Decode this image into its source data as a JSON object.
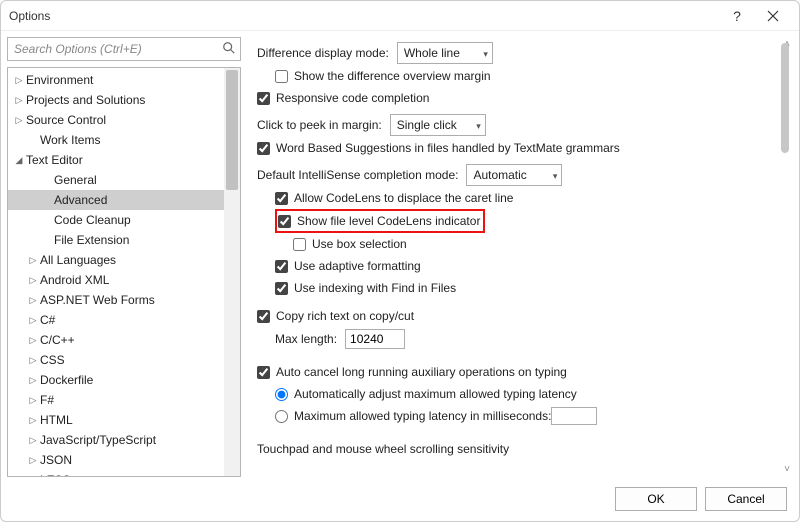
{
  "title": "Options",
  "search": {
    "placeholder": "Search Options (Ctrl+E)"
  },
  "tree": {
    "items": [
      {
        "label": "Environment",
        "glyph": "▷",
        "indent": 4
      },
      {
        "label": "Projects and Solutions",
        "glyph": "▷",
        "indent": 4
      },
      {
        "label": "Source Control",
        "glyph": "▷",
        "indent": 4
      },
      {
        "label": "Work Items",
        "glyph": "",
        "indent": 18
      },
      {
        "label": "Text Editor",
        "glyph": "◢",
        "indent": 4
      },
      {
        "label": "General",
        "glyph": "",
        "indent": 32
      },
      {
        "label": "Advanced",
        "glyph": "",
        "indent": 32,
        "selected": true
      },
      {
        "label": "Code Cleanup",
        "glyph": "",
        "indent": 32
      },
      {
        "label": "File Extension",
        "glyph": "",
        "indent": 32
      },
      {
        "label": "All Languages",
        "glyph": "▷",
        "indent": 18
      },
      {
        "label": "Android XML",
        "glyph": "▷",
        "indent": 18
      },
      {
        "label": "ASP.NET Web Forms",
        "glyph": "▷",
        "indent": 18
      },
      {
        "label": "C#",
        "glyph": "▷",
        "indent": 18
      },
      {
        "label": "C/C++",
        "glyph": "▷",
        "indent": 18
      },
      {
        "label": "CSS",
        "glyph": "▷",
        "indent": 18
      },
      {
        "label": "Dockerfile",
        "glyph": "▷",
        "indent": 18
      },
      {
        "label": "F#",
        "glyph": "▷",
        "indent": 18
      },
      {
        "label": "HTML",
        "glyph": "▷",
        "indent": 18
      },
      {
        "label": "JavaScript/TypeScript",
        "glyph": "▷",
        "indent": 18
      },
      {
        "label": "JSON",
        "glyph": "▷",
        "indent": 18
      },
      {
        "label": "LESS",
        "glyph": "▷",
        "indent": 18
      }
    ]
  },
  "panel": {
    "diff_mode_label": "Difference display mode:",
    "diff_mode_value": "Whole line",
    "show_diff_margin": "Show the difference overview margin",
    "responsive_completion": "Responsive code completion",
    "peek_label": "Click to peek in margin:",
    "peek_value": "Single click",
    "word_based": "Word Based Suggestions in files handled by TextMate grammars",
    "intellisense_label": "Default IntelliSense completion mode:",
    "intellisense_value": "Automatic",
    "allow_codelens": "Allow CodeLens to displace the caret line",
    "show_file_level": "Show file level CodeLens indicator",
    "use_box_selection": "Use box selection",
    "use_adaptive": "Use adaptive formatting",
    "use_indexing": "Use indexing with Find in Files",
    "copy_rich": "Copy rich text on copy/cut",
    "max_length_label": "Max length:",
    "max_length_value": "10240",
    "auto_cancel": "Auto cancel long running auxiliary operations on typing",
    "radio_auto": "Automatically adjust maximum allowed typing latency",
    "radio_max": "Maximum allowed typing latency in milliseconds:",
    "touchpad": "Touchpad and mouse wheel scrolling sensitivity"
  },
  "footer": {
    "ok": "OK",
    "cancel": "Cancel"
  }
}
